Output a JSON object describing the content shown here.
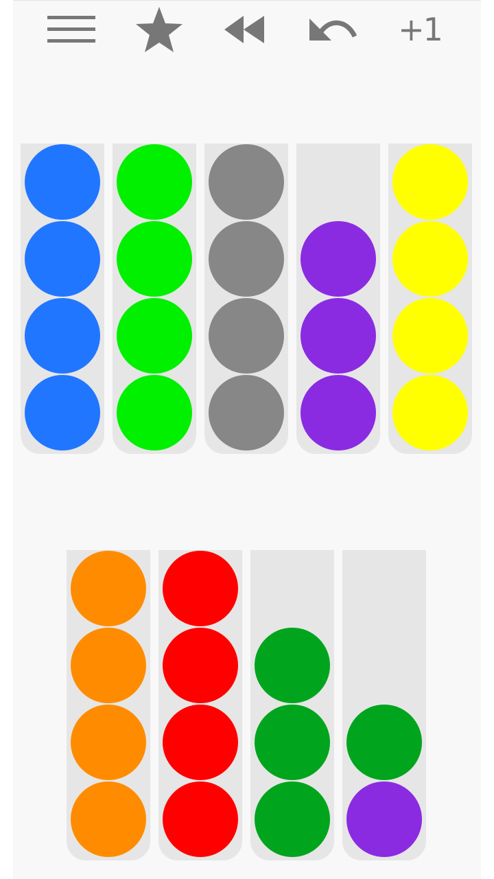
{
  "toolbar": {
    "menu_icon": "hamburger-menu-icon",
    "star_icon": "star-icon",
    "restart_icon": "rewind-icon",
    "undo_icon": "undo-icon",
    "add_tube_label": "+1"
  },
  "colors": {
    "blue": "#2176ff",
    "green": "#00f000",
    "gray": "#878787",
    "purple": "#8a2be2",
    "yellow": "#ffff00",
    "orange": "#ff8c00",
    "red": "#ff0000",
    "dark_green": "#00a51d",
    "icon": "#777777",
    "tube": "#e6e6e6",
    "board": "#f8f8f8"
  },
  "tube_capacity": 4,
  "tubes": [
    {
      "id": 1,
      "balls": [
        "blue",
        "blue",
        "blue",
        "blue"
      ]
    },
    {
      "id": 2,
      "balls": [
        "green",
        "green",
        "green",
        "green"
      ]
    },
    {
      "id": 3,
      "balls": [
        "gray",
        "gray",
        "gray",
        "gray"
      ]
    },
    {
      "id": 4,
      "balls": [
        "purple",
        "purple",
        "purple"
      ]
    },
    {
      "id": 5,
      "balls": [
        "yellow",
        "yellow",
        "yellow",
        "yellow"
      ]
    },
    {
      "id": 6,
      "balls": [
        "orange",
        "orange",
        "orange",
        "orange"
      ]
    },
    {
      "id": 7,
      "balls": [
        "red",
        "red",
        "red",
        "red"
      ]
    },
    {
      "id": 8,
      "balls": [
        "dark_green",
        "dark_green",
        "dark_green"
      ]
    },
    {
      "id": 9,
      "balls": [
        "dark_green",
        "purple"
      ]
    }
  ]
}
